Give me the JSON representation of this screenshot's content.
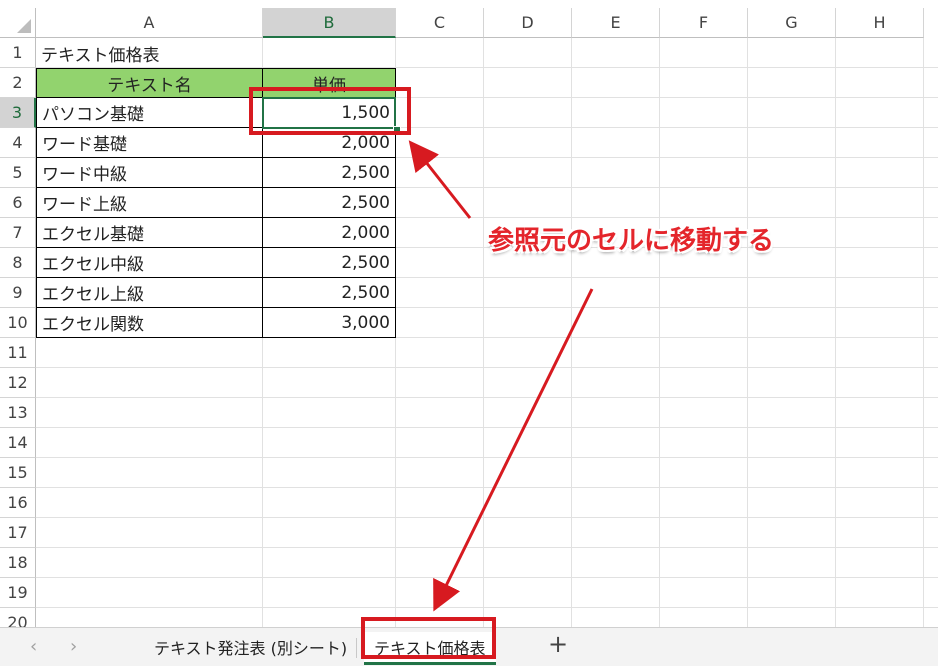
{
  "columns": [
    "A",
    "B",
    "C",
    "D",
    "E",
    "F",
    "G",
    "H"
  ],
  "rows": [
    "1",
    "2",
    "3",
    "4",
    "5",
    "6",
    "7",
    "8",
    "9",
    "10",
    "11",
    "12",
    "13",
    "14",
    "15",
    "16",
    "17",
    "18",
    "19",
    "20"
  ],
  "sheet": {
    "title": "テキスト価格表",
    "header_name": "テキスト名",
    "header_price": "単価",
    "items": [
      {
        "name": "パソコン基礎",
        "price": "1,500"
      },
      {
        "name": "ワード基礎",
        "price": "2,000"
      },
      {
        "name": "ワード中級",
        "price": "2,500"
      },
      {
        "name": "ワード上級",
        "price": "2,500"
      },
      {
        "name": "エクセル基礎",
        "price": "2,000"
      },
      {
        "name": "エクセル中級",
        "price": "2,500"
      },
      {
        "name": "エクセル上級",
        "price": "2,500"
      },
      {
        "name": "エクセル関数",
        "price": "3,000"
      }
    ]
  },
  "tabs": {
    "prev": "‹",
    "next": "›",
    "sheet1": "テキスト発注表 (別シート)",
    "sheet2": "テキスト価格表",
    "add": "+"
  },
  "annotation": "参照元のセルに移動する",
  "colors": {
    "accent": "#e4252b",
    "header_fill": "#92d36e",
    "excel_green": "#217346"
  }
}
